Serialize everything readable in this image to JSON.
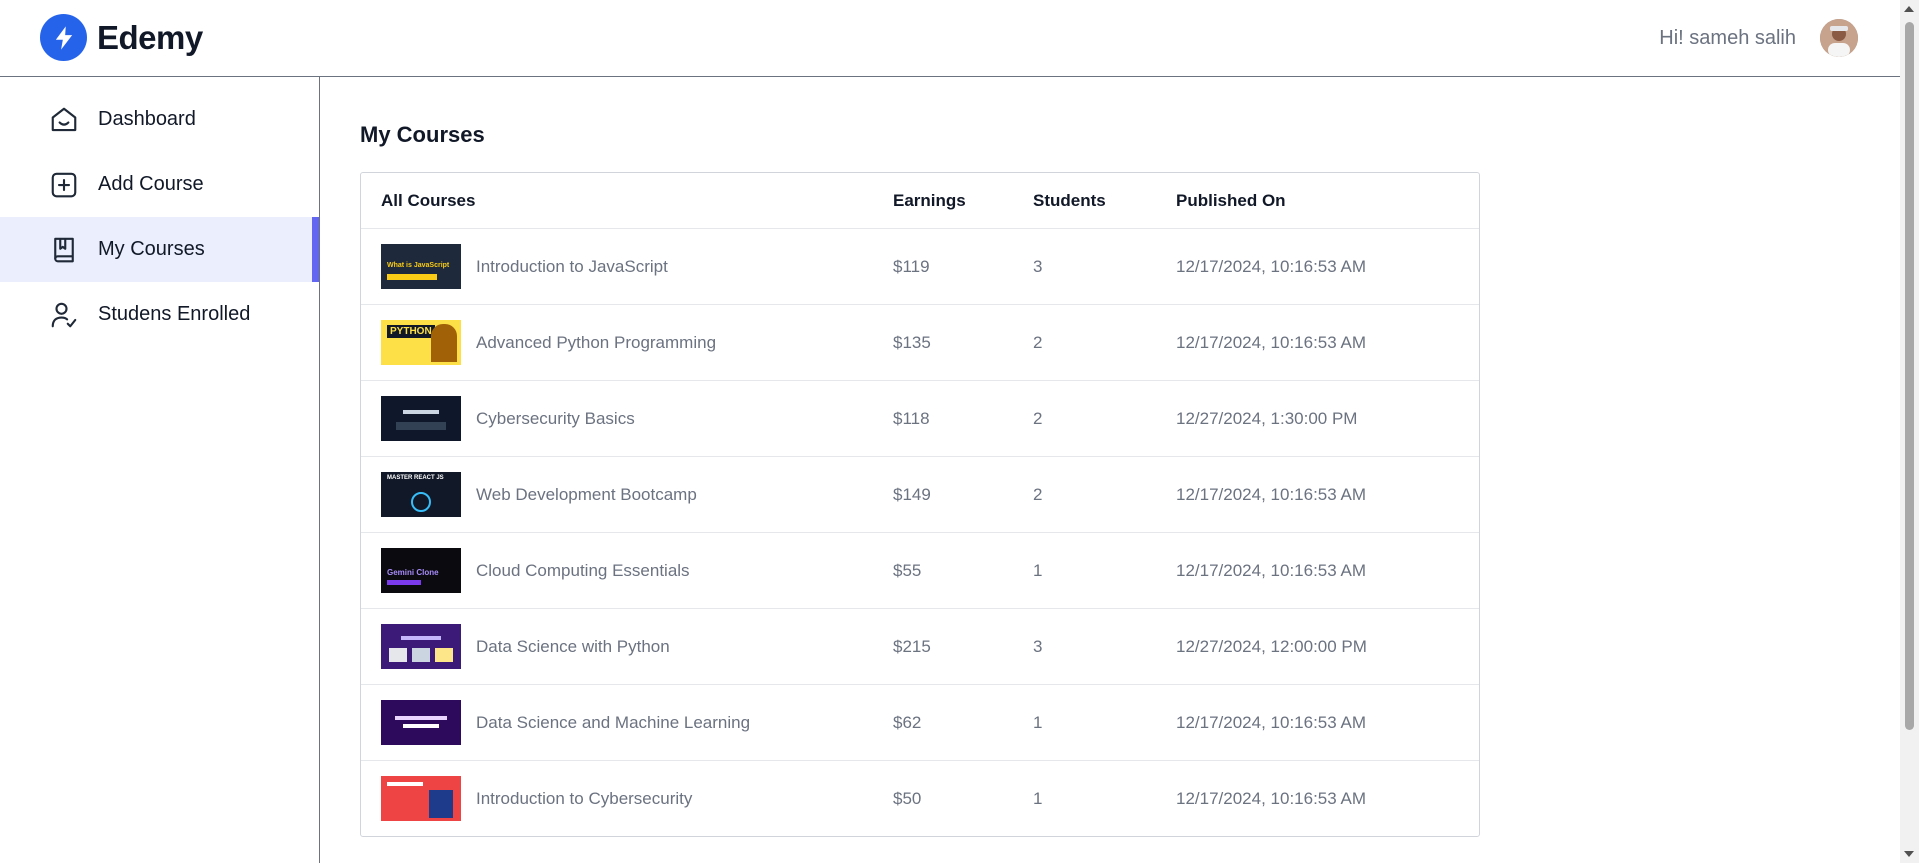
{
  "header": {
    "brand": "Edemy",
    "greeting": "Hi! sameh salih"
  },
  "sidebar": {
    "items": [
      {
        "label": "Dashboard",
        "icon": "home-icon",
        "active": false
      },
      {
        "label": "Add Course",
        "icon": "plus-square-icon",
        "active": true
      },
      {
        "label": "My Courses",
        "icon": "book-icon",
        "active": true
      },
      {
        "label": "Studens Enrolled",
        "icon": "user-check-icon",
        "active": false
      }
    ]
  },
  "main": {
    "title": "My Courses",
    "columns": [
      "All Courses",
      "Earnings",
      "Students",
      "Published On"
    ],
    "rows": [
      {
        "course": "Introduction to JavaScript",
        "earnings": "$119",
        "students": "3",
        "published": "12/17/2024, 10:16:53 AM",
        "thumb_text": "What is JavaScript",
        "thumb_bg": "#1e293b",
        "thumb_fg": "#facc15"
      },
      {
        "course": "Advanced Python Programming",
        "earnings": "$135",
        "students": "2",
        "published": "12/17/2024, 10:16:53 AM",
        "thumb_text": "PYTHON",
        "thumb_bg": "#fde047",
        "thumb_fg": "#111827"
      },
      {
        "course": "Cybersecurity Basics",
        "earnings": "$118",
        "students": "2",
        "published": "12/27/2024, 1:30:00 PM",
        "thumb_text": "",
        "thumb_bg": "#0f172a",
        "thumb_fg": "#e5e7eb"
      },
      {
        "course": "Web Development Bootcamp",
        "earnings": "$149",
        "students": "2",
        "published": "12/17/2024, 10:16:53 AM",
        "thumb_text": "MASTER REACT JS",
        "thumb_bg": "#111827",
        "thumb_fg": "#ffffff"
      },
      {
        "course": "Cloud Computing Essentials",
        "earnings": "$55",
        "students": "1",
        "published": "12/17/2024, 10:16:53 AM",
        "thumb_text": "Gemini Clone",
        "thumb_bg": "#0b0b0f",
        "thumb_fg": "#a78bfa"
      },
      {
        "course": "Data Science with Python",
        "earnings": "$215",
        "students": "3",
        "published": "12/27/2024, 12:00:00 PM",
        "thumb_text": "",
        "thumb_bg": "#3b1a78",
        "thumb_fg": "#ffffff"
      },
      {
        "course": "Data Science and Machine Learning",
        "earnings": "$62",
        "students": "1",
        "published": "12/17/2024, 10:16:53 AM",
        "thumb_text": "",
        "thumb_bg": "#2e0a5c",
        "thumb_fg": "#ffffff"
      },
      {
        "course": "Introduction to Cybersecurity",
        "earnings": "$50",
        "students": "1",
        "published": "12/17/2024, 10:16:53 AM",
        "thumb_text": "",
        "thumb_bg": "#ef4444",
        "thumb_fg": "#ffffff"
      }
    ]
  },
  "colors": {
    "accent": "#6366f1",
    "brand": "#2563eb",
    "active_bg": "#ebeffd"
  }
}
